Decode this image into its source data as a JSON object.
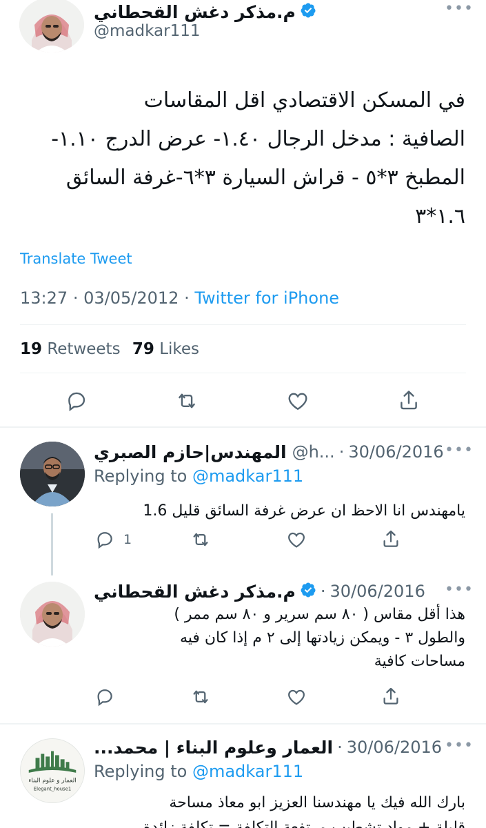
{
  "main_tweet": {
    "author_name": "م.مذكر دغش القحطاني",
    "handle": "@madkar111",
    "text_lines": [
      "في المسكن الاقتصادي اقل المقاسات",
      "الصافية : مدخل الرجال ١.٤٠- عرض الدرج ١.١٠-",
      "المطبخ ٣*٥ - قراش السيارة ٣*٦-غرفة السائق",
      "١.٦*٣"
    ],
    "translate_label": "Translate Tweet",
    "time": "13:27",
    "date": "03/05/2012",
    "separator": "·",
    "source": "Twitter for iPhone",
    "retweets_count": "19",
    "retweets_label": "Retweets",
    "likes_count": "79",
    "likes_label": "Likes"
  },
  "replies": [
    {
      "author_name": "المهندس|حازم الصبري",
      "handle": "@h...",
      "date": "30/06/2016",
      "replying_prefix": "Replying to",
      "replying_to": "@madkar111",
      "text_lines": [
        "يامهندس انا الاحظ ان عرض غرفة السائق قليل 1.6"
      ],
      "reply_count": "1"
    },
    {
      "author_name": "م.مذكر دغش القحطاني",
      "date": "30/06/2016",
      "text_lines": [
        "هذا أقل مقاس ( ٨٠ سم سرير و ٨٠ سم ممر )",
        "والطول ٣ - ويمكن زيادتها إلى ٢ م إذا كان فيه",
        "مساحات كافية"
      ]
    },
    {
      "author_name": "العمار وعلوم البناء | محمد...",
      "date": "30/06/2016",
      "replying_prefix": "Replying to",
      "replying_to": "@madkar111",
      "avatar_text": "العمار و علوم البناء",
      "avatar_handle": "Elegant_house1",
      "text_lines": [
        "بارك الله فيك يا مهندسنا العزيز ابو معاذ  مساحة",
        "قليلة + مواد تشطيب مرتفعة التكلفة = تكلفة زائدة"
      ]
    }
  ],
  "colors": {
    "accent": "#1d9bf0",
    "text": "#0f1419",
    "muted": "#536471",
    "divider": "#eff3f4",
    "logo_green": "#3f7b4a"
  }
}
